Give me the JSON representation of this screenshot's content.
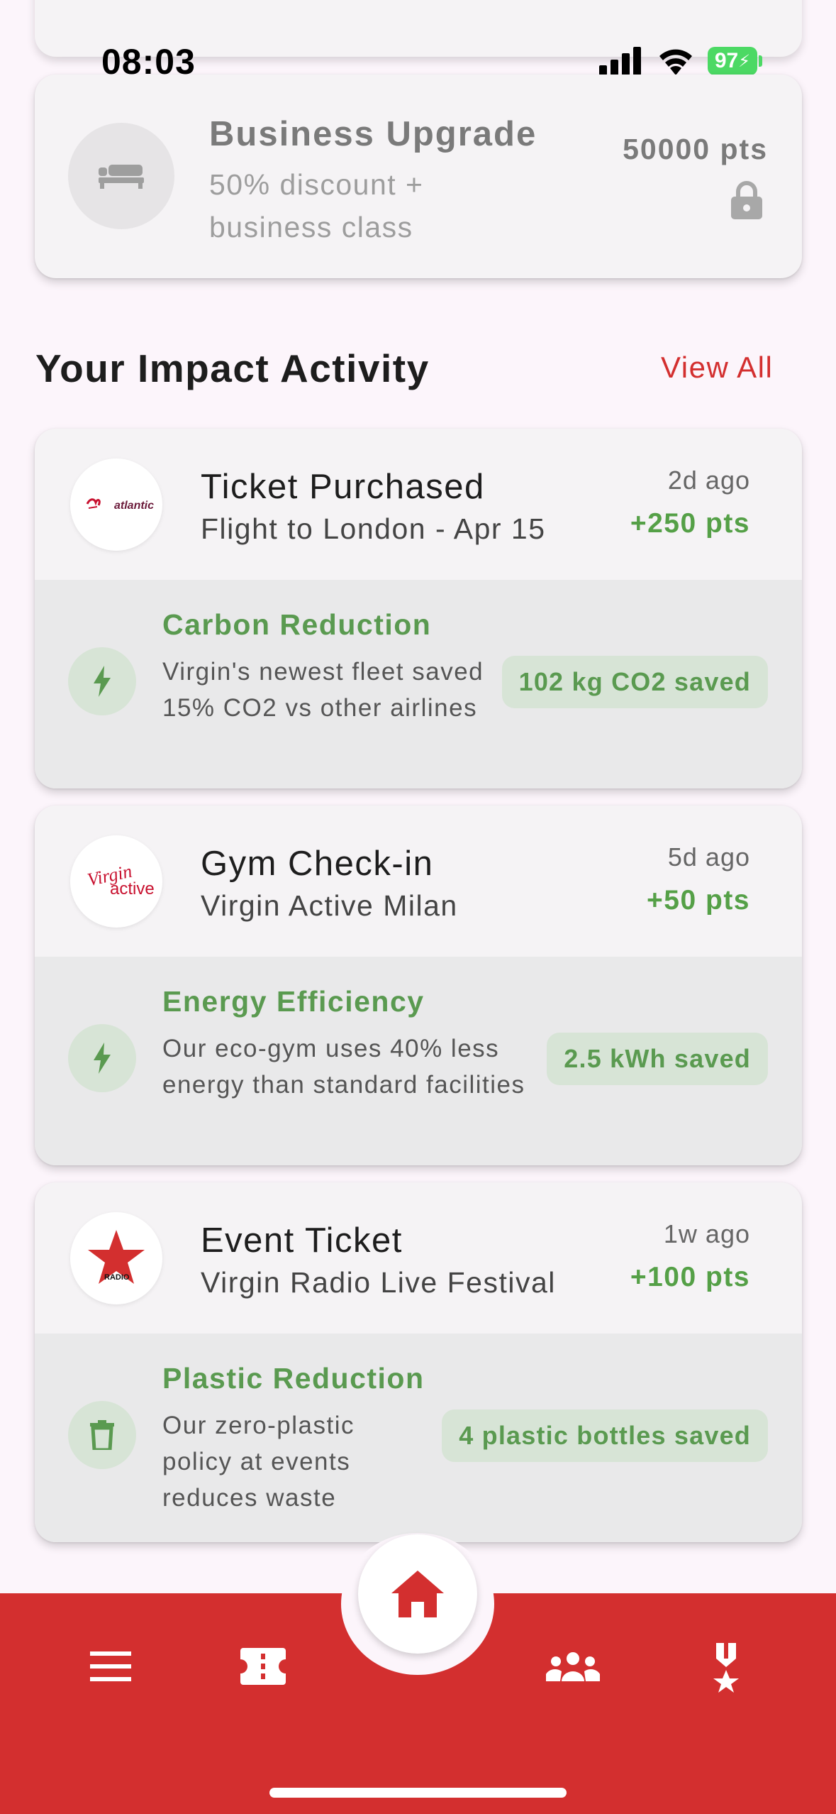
{
  "status_bar": {
    "time": "08:03",
    "battery": "97"
  },
  "reward_card": {
    "title": "Business Upgrade",
    "description": "50% discount + business class",
    "points": "50000 pts"
  },
  "section": {
    "title": "Your Impact Activity",
    "view_all": "View All"
  },
  "activities": [
    {
      "logo": "virgin-atlantic",
      "logo_text": "atlantic",
      "title": "Ticket Purchased",
      "subtitle": "Flight to London - Apr 15",
      "time": "2d ago",
      "points": "+250 pts",
      "impact": {
        "icon": "bolt-icon",
        "title": "Carbon Reduction",
        "description": "Virgin's newest fleet saved 15% CO2 vs other airlines",
        "badge": "102 kg CO2 saved"
      }
    },
    {
      "logo": "virgin-active",
      "logo_text": "active",
      "title": "Gym Check-in",
      "subtitle": "Virgin Active Milan",
      "time": "5d ago",
      "points": "+50 pts",
      "impact": {
        "icon": "bolt-icon",
        "title": "Energy Efficiency",
        "description": "Our eco-gym uses 40% less energy than standard facilities",
        "badge": "2.5 kWh saved"
      }
    },
    {
      "logo": "virgin-radio",
      "logo_text": "RADIO",
      "title": "Event Ticket",
      "subtitle": "Virgin Radio Live Festival",
      "time": "1w ago",
      "points": "+100 pts",
      "impact": {
        "icon": "trash-icon",
        "title": "Plastic Reduction",
        "description": "Our zero-plastic policy at events reduces waste",
        "badge": "4 plastic bottles saved"
      }
    }
  ],
  "nav": {
    "items": [
      "menu-icon",
      "ticket-icon",
      "home-icon",
      "group-icon",
      "medal-icon"
    ],
    "active": "home-icon"
  },
  "colors": {
    "brand_red": "#d32f2f",
    "green": "#5a9a50",
    "badge_bg": "#d7e4d6"
  }
}
